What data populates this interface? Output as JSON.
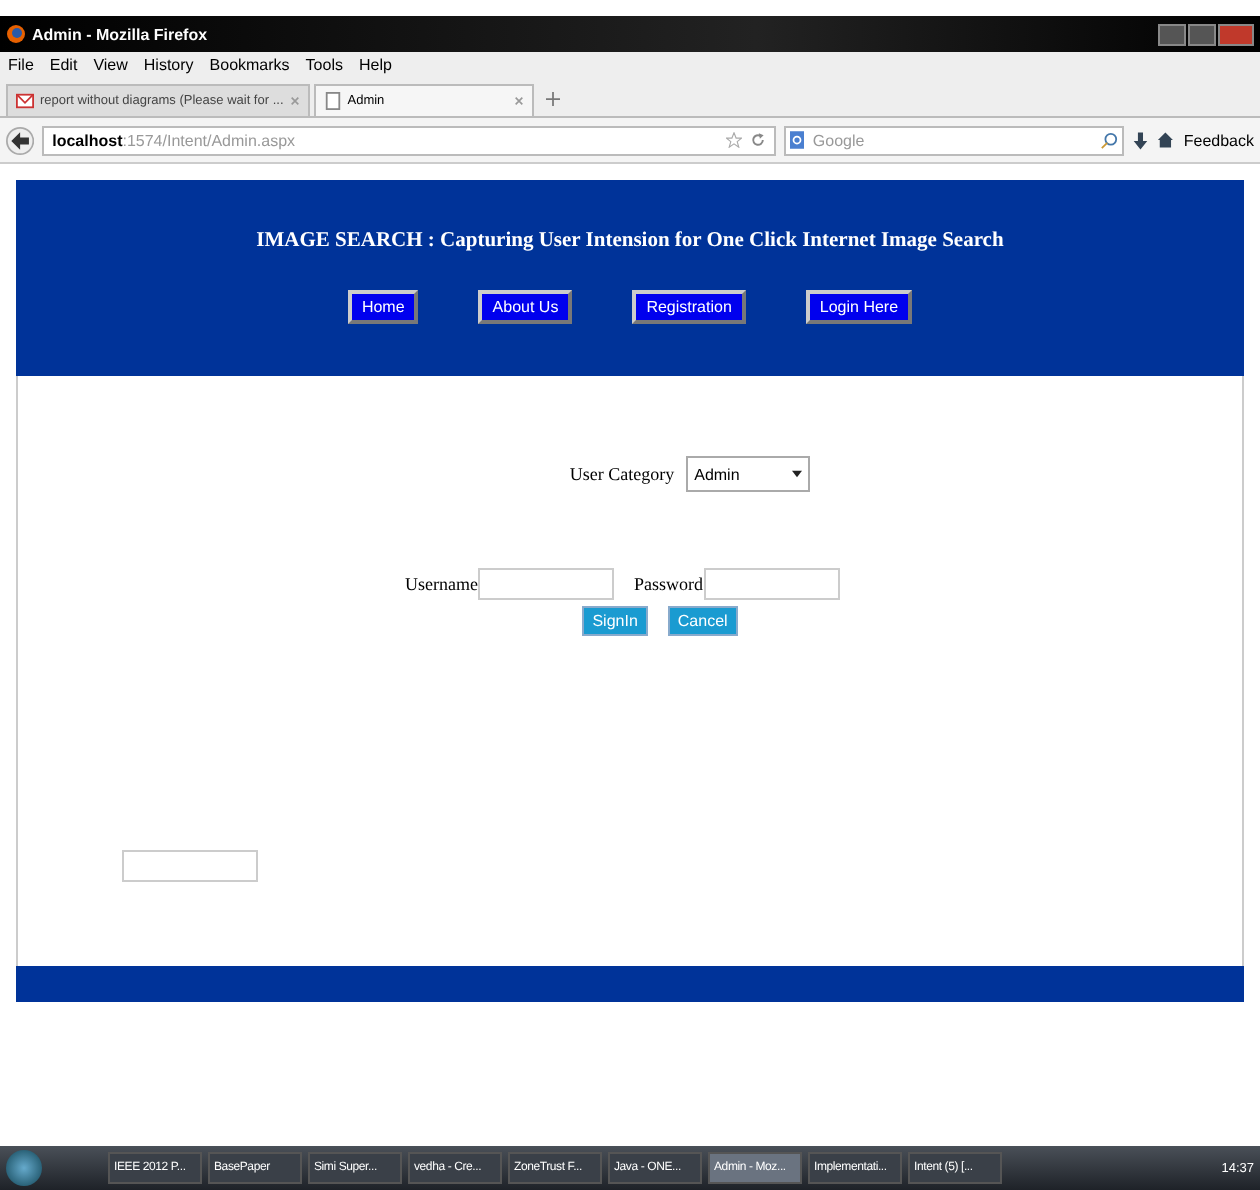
{
  "window": {
    "title": "Admin - Mozilla Firefox"
  },
  "menu": [
    "File",
    "Edit",
    "View",
    "History",
    "Bookmarks",
    "Tools",
    "Help"
  ],
  "tabs": [
    {
      "label": "report without diagrams (Please wait for ...",
      "selected": false,
      "kind": "mail"
    },
    {
      "label": "Admin",
      "selected": true,
      "kind": "page"
    }
  ],
  "address": {
    "value_host": "localhost",
    "value_path": ":1574/Intent/Admin.aspx"
  },
  "search": {
    "placeholder": "Google"
  },
  "toolbar": {
    "feedback": "Feedback"
  },
  "page": {
    "title": "IMAGE SEARCH : Capturing User Intension for One Click Internet Image Search",
    "nav": [
      "Home",
      "About Us",
      "Registration",
      "Login Here"
    ],
    "category_label": "User Category",
    "category_value": "Admin",
    "username_label": "Username",
    "password_label": "Password",
    "buttons": [
      "SignIn",
      "Cancel"
    ]
  },
  "taskbar": {
    "items": [
      {
        "label": "IEEE 2012 P...",
        "selected": false
      },
      {
        "label": "BasePaper",
        "selected": false
      },
      {
        "label": "Simi Super...",
        "selected": false
      },
      {
        "label": "vedha - Cre...",
        "selected": false
      },
      {
        "label": "ZoneTrust F...",
        "selected": false
      },
      {
        "label": "Java - ONE...",
        "selected": false
      },
      {
        "label": "Admin - Moz...",
        "selected": true
      },
      {
        "label": "Implementati...",
        "selected": false
      },
      {
        "label": "Intent (5) [...",
        "selected": false
      }
    ],
    "time": "14:37"
  }
}
